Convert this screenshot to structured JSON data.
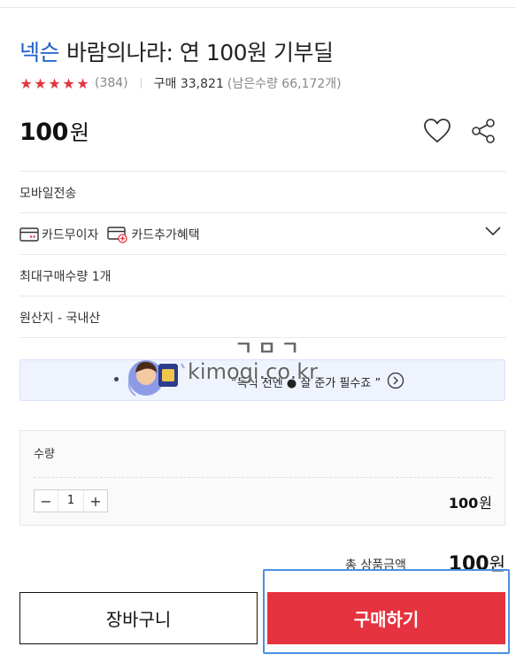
{
  "product": {
    "brand": "넥슨",
    "name": "바람의나라: 연 100원 기부딜",
    "rating_stars": 5,
    "review_count": "(384)",
    "sold": "구매 33,821",
    "remaining": "(남은수량 66,172개)",
    "price": "100",
    "price_unit": "원"
  },
  "actions": {
    "wishlist_icon": "heart-icon",
    "share_icon": "share-icon"
  },
  "info": {
    "delivery": "모바일전송",
    "card_interest_free": "카드무이자",
    "card_extra_benefits": "카드추가혜택",
    "max_purchase": "최대구매수량 1개",
    "origin": "원산지 - 국내산"
  },
  "banner": {
    "text": "“독식 전엔 ● 잘 준가 필수죠 ”"
  },
  "watermark": {
    "top": "ㄱㅁㄱ",
    "bottom": "kimogi.co.kr"
  },
  "quantity": {
    "label": "수량",
    "value": "1",
    "minus": "−",
    "plus": "+",
    "subtotal": "100",
    "subtotal_unit": "원"
  },
  "total": {
    "label": "총 상품금액",
    "amount": "100",
    "unit": "원"
  },
  "buttons": {
    "cart": "장바구니",
    "buy": "구매하기"
  },
  "colors": {
    "brand_blue": "#1f5fc8",
    "accent_red": "#e5333f",
    "highlight_outline": "#4a90e2"
  }
}
